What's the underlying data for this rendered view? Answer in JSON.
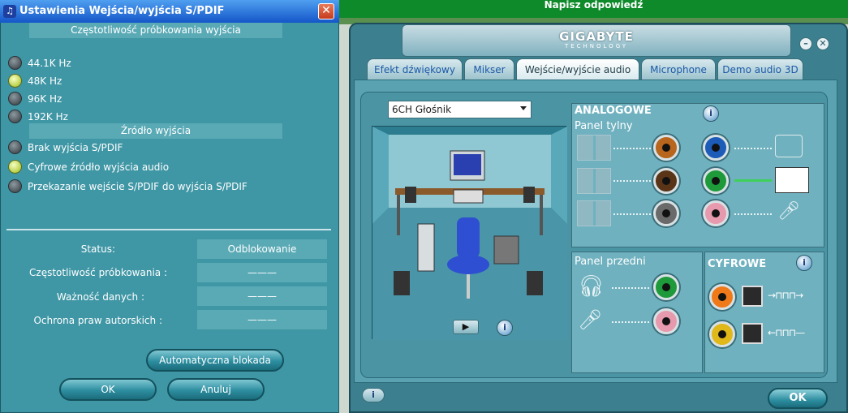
{
  "background": {
    "header_text": "Napisz odpowiedź"
  },
  "dialog": {
    "title": "Ustawienia Wejścia/wyjścia S/PDIF",
    "close_label": "✕",
    "sampling_header": "Częstotliwość próbkowania wyjścia",
    "sampling_options": [
      "44.1K Hz",
      "48K Hz",
      "96K Hz",
      "192K Hz"
    ],
    "sampling_selected": "48K Hz",
    "source_header": "Źródło wyjścia",
    "source_options": [
      "Brak wyjścia S/PDIF",
      "Cyfrowe źródło wyjścia audio",
      "Przekazanie wejście S/PDIF do wyjścia S/PDIF"
    ],
    "source_selected": "Cyfrowe źródło wyjścia audio",
    "status_rows": [
      {
        "label": "Status:",
        "value": "Odblokowanie"
      },
      {
        "label": "Częstotliwość próbkowania :",
        "value": "———"
      },
      {
        "label": "Ważność danych :",
        "value": "———"
      },
      {
        "label": "Ochrona praw autorskich :",
        "value": "———"
      }
    ],
    "auto_lock_label": "Automatyczna blokada",
    "ok_label": "OK",
    "cancel_label": "Anuluj"
  },
  "gigabyte": {
    "logo": "GIGABYTE",
    "logo_sub": "TECHNOLOGY",
    "minimize_label": "–",
    "close_label": "✕",
    "tabs": [
      "Efekt dźwiękowy",
      "Mikser",
      "Wejście/wyjście audio",
      "Microphone",
      "Demo audio 3D"
    ],
    "active_tab": "Wejście/wyjście audio",
    "speaker_select": "6CH Głośnik",
    "analog_title": "ANALOGOWE",
    "rear_panel": "Panel tylny",
    "front_panel": "Panel przedni",
    "digital_title": "CYFROWE",
    "info_label": "i",
    "ok_label": "OK",
    "jack_colors": {
      "orange": "#b8651d",
      "brown": "#5a3417",
      "grey": "#6a6a6a",
      "blue": "#1c5bb8",
      "green": "#1e9a3a",
      "pink": "#e79aae"
    }
  }
}
